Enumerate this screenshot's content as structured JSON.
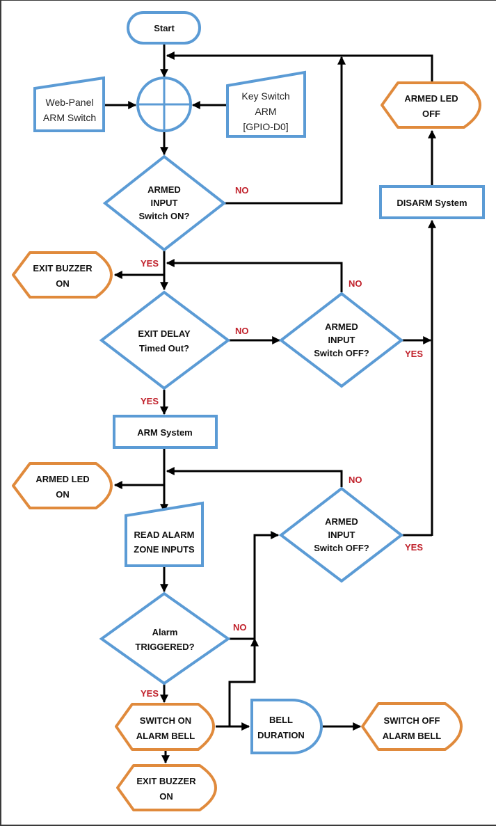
{
  "diagram": {
    "nodes": {
      "start": {
        "lines": [
          "Start"
        ]
      },
      "web_panel": {
        "lines": [
          "Web-Panel",
          "ARM Switch"
        ]
      },
      "key_switch": {
        "lines": [
          "Key Switch",
          "ARM",
          "[GPIO-D0]"
        ]
      },
      "armed_input_on": {
        "lines": [
          "ARMED",
          "INPUT",
          "Switch ON?"
        ]
      },
      "exit_buzzer_on_1": {
        "lines": [
          "EXIT BUZZER",
          "ON"
        ]
      },
      "exit_delay": {
        "lines": [
          "EXIT DELAY",
          "Timed Out?"
        ]
      },
      "armed_input_off_1": {
        "lines": [
          "ARMED",
          "INPUT",
          "Switch OFF?"
        ]
      },
      "arm_system": {
        "lines": [
          "ARM System"
        ]
      },
      "armed_led_on": {
        "lines": [
          "ARMED LED",
          "ON"
        ]
      },
      "read_alarm": {
        "lines": [
          "READ ALARM",
          "ZONE INPUTS"
        ]
      },
      "armed_input_off_2": {
        "lines": [
          "ARMED",
          "INPUT",
          "Switch OFF?"
        ]
      },
      "alarm_triggered": {
        "lines": [
          "Alarm",
          "TRIGGERED?"
        ]
      },
      "switch_on_bell": {
        "lines": [
          "SWITCH ON",
          "ALARM BELL"
        ]
      },
      "bell_duration": {
        "lines": [
          "BELL",
          "DURATION"
        ]
      },
      "switch_off_bell": {
        "lines": [
          "SWITCH OFF",
          "ALARM BELL"
        ]
      },
      "exit_buzzer_on_2": {
        "lines": [
          "EXIT BUZZER",
          "ON"
        ]
      },
      "disarm_system": {
        "lines": [
          "DISARM System"
        ]
      },
      "armed_led_off": {
        "lines": [
          "ARMED LED",
          "OFF"
        ]
      }
    },
    "branch_labels": {
      "yes": "YES",
      "no": "NO"
    },
    "colors": {
      "process_stroke": "#5b9bd5",
      "display_stroke": "#e08a3c",
      "branch_label": "#c0202a",
      "connector": "#000000"
    }
  }
}
